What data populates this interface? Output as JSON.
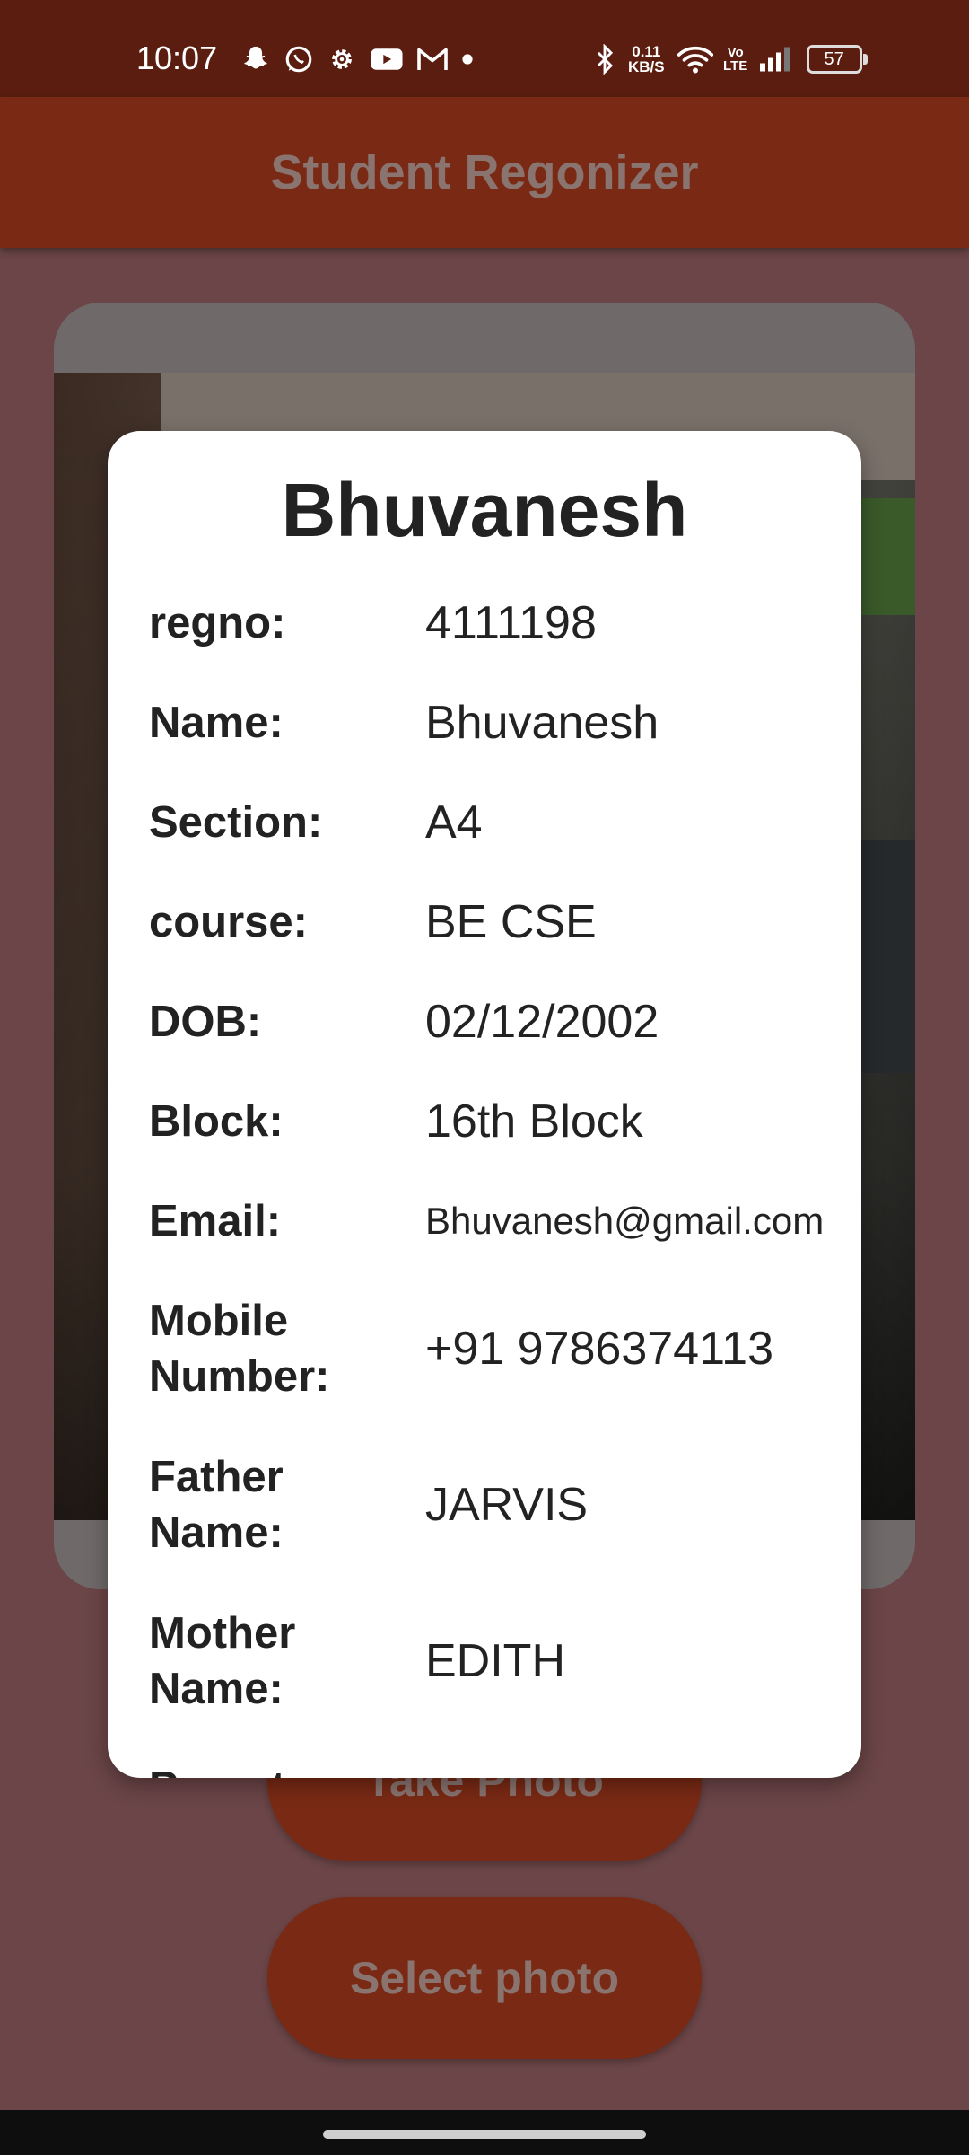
{
  "status_bar": {
    "time": "10:07",
    "left_icons": [
      "snapchat-icon",
      "whatsapp-icon",
      "settings-gear-icon",
      "youtube-icon",
      "gmail-icon",
      "dot-icon"
    ],
    "net_speed_value": "0.11",
    "net_speed_unit": "KB/S",
    "volte_label": "Vo LTE",
    "battery_level": "57"
  },
  "app_bar": {
    "title": "Student Regonizer"
  },
  "buttons": {
    "take_photo": "Take Photo",
    "select_photo": "Select photo"
  },
  "dialog": {
    "title": "Bhuvanesh",
    "rows": [
      {
        "label": "regno:",
        "value": "4111198"
      },
      {
        "label": "Name:",
        "value": "Bhuvanesh"
      },
      {
        "label": "Section:",
        "value": "A4"
      },
      {
        "label": "course:",
        "value": "BE CSE"
      },
      {
        "label": "DOB:",
        "value": "02/12/2002"
      },
      {
        "label": "Block:",
        "value": "16th Block"
      },
      {
        "label": "Email:",
        "value": "Bhuvanesh@gmail.com"
      },
      {
        "label": "Mobile Number:",
        "value": "+91 9786374113"
      },
      {
        "label": "Father Name:",
        "value": "JARVIS"
      },
      {
        "label": "Mother Name:",
        "value": "EDITH"
      },
      {
        "label": "Parent",
        "value": ""
      }
    ]
  }
}
